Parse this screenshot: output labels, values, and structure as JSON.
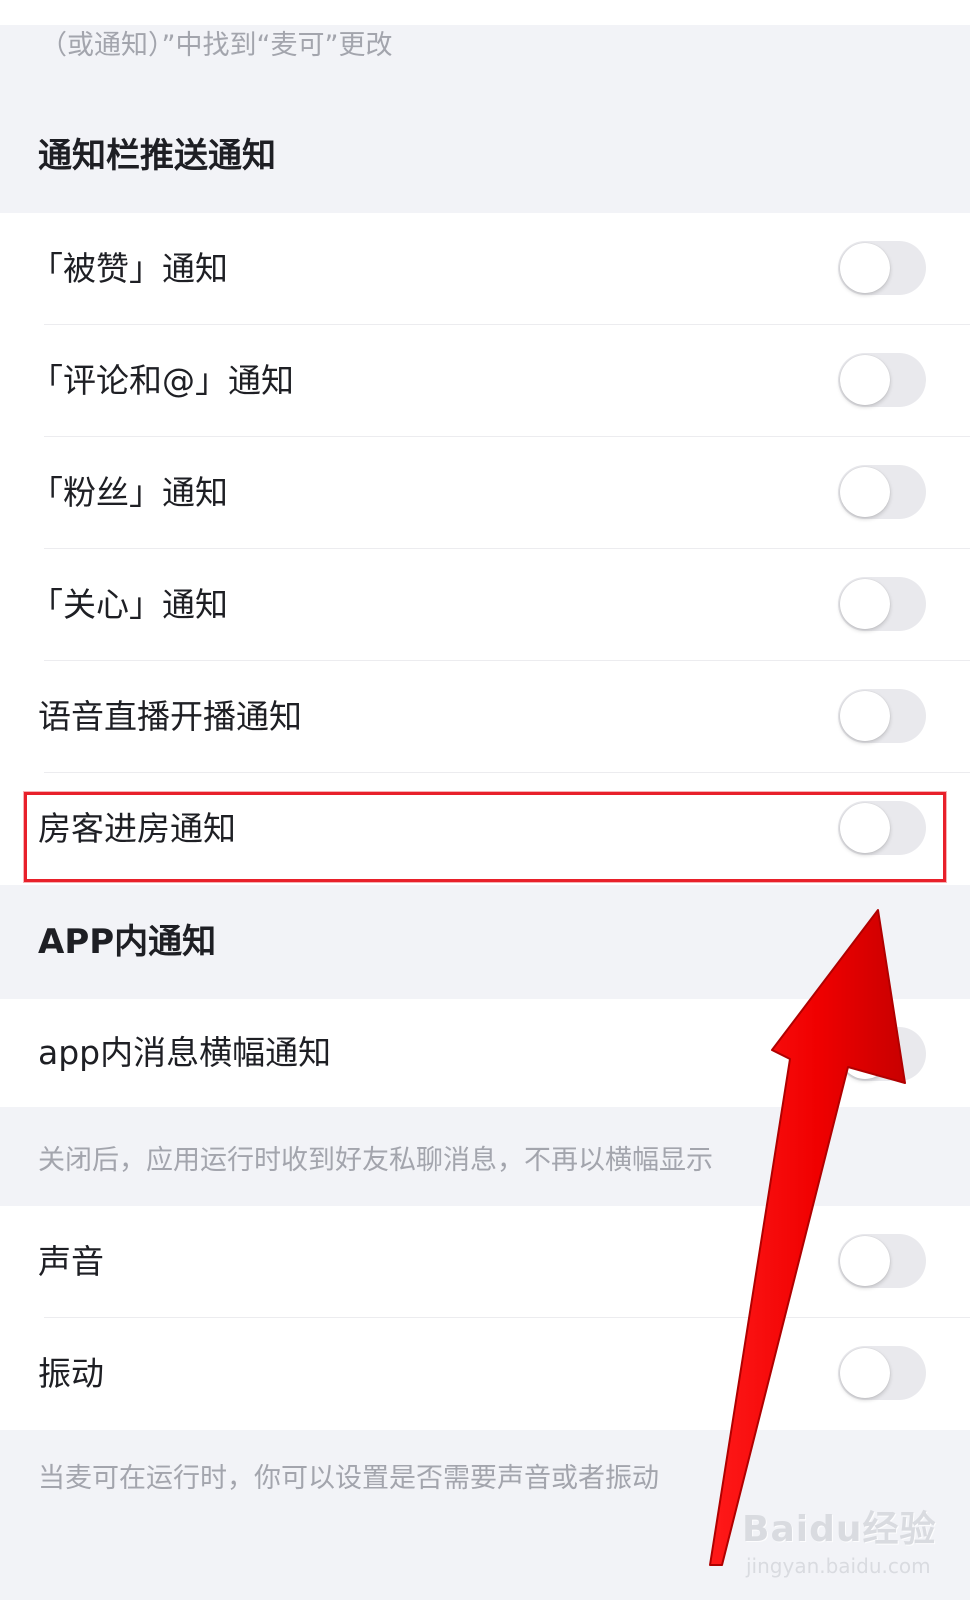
{
  "top_hint": "（或通知）”中找到“麦可”更改",
  "sections": {
    "push": {
      "title": "通知栏推送通知",
      "items": [
        {
          "label": "「被赞」通知",
          "on": false
        },
        {
          "label": "「评论和@」通知",
          "on": false
        },
        {
          "label": "「粉丝」通知",
          "on": false
        },
        {
          "label": "「关心」通知",
          "on": false
        },
        {
          "label": "语音直播开播通知",
          "on": false
        },
        {
          "label": "房客进房通知",
          "on": false
        }
      ]
    },
    "in_app": {
      "title": "APP内通知",
      "banner_label": "app内消息横幅通知",
      "banner_on": false,
      "banner_hint": "关闭后，应用运行时收到好友私聊消息，不再以横幅显示"
    },
    "sound": {
      "items": [
        {
          "label": "声音",
          "on": false
        },
        {
          "label": "振动",
          "on": false
        }
      ],
      "hint": "当麦可在运行时，你可以设置是否需要声音或者振动"
    }
  },
  "watermark": {
    "main": "Baidu经验",
    "sub": "jingyan.baidu.com"
  },
  "colors": {
    "background": "#f2f3f7",
    "text": "#1e1f24",
    "hint": "#a3a5ad",
    "toggle_off": "#e9e9ed",
    "annotation_red": "#e8202a"
  }
}
